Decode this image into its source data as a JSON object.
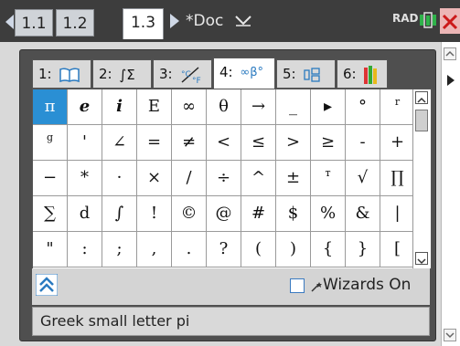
{
  "topbar": {
    "tabs": [
      "1.1",
      "1.2",
      "1.3"
    ],
    "active_tab_index": 2,
    "doc_title": "*Doc",
    "mode": "RAD"
  },
  "catalog": {
    "tabs": [
      {
        "label": "1:",
        "icon": "book-icon"
      },
      {
        "label": "2:",
        "icon": "integral-sigma-icon",
        "icon_text": "∫Σ"
      },
      {
        "label": "3:",
        "icon": "units-icon"
      },
      {
        "label": "4:",
        "icon": "symbols-icon",
        "icon_text": "∞β°"
      },
      {
        "label": "5:",
        "icon": "templates-icon"
      },
      {
        "label": "6:",
        "icon": "libraries-icon"
      }
    ],
    "active_tab_index": 3,
    "symbols": [
      [
        "π",
        "e",
        "i",
        "E",
        "∞",
        "θ",
        "→",
        "_",
        "▸",
        "°",
        "r"
      ],
      [
        "g",
        "'",
        "∠",
        "=",
        "≠",
        "<",
        "≤",
        ">",
        "≥",
        "-",
        "+"
      ],
      [
        "−",
        "*",
        "·",
        "×",
        "/",
        "÷",
        "^",
        "±",
        "т",
        "√",
        "∏"
      ],
      [
        "∑",
        "d",
        "∫",
        "!",
        "©",
        "@",
        "#",
        "$",
        "%",
        "&",
        "|"
      ],
      [
        "\"",
        ":",
        ";",
        ",",
        ".",
        "?",
        "(",
        ")",
        "{",
        "}",
        "["
      ]
    ],
    "selected": {
      "row": 0,
      "col": 0
    },
    "wizards_label": "Wizards On",
    "wizards_checked": false,
    "description": "Greek small letter pi"
  },
  "colors": {
    "selected_cell": "#2a8fd4",
    "topbar": "#3d3d3d",
    "catalog_frame": "#4f4f4f",
    "accent_blue": "#2a7ac0"
  }
}
